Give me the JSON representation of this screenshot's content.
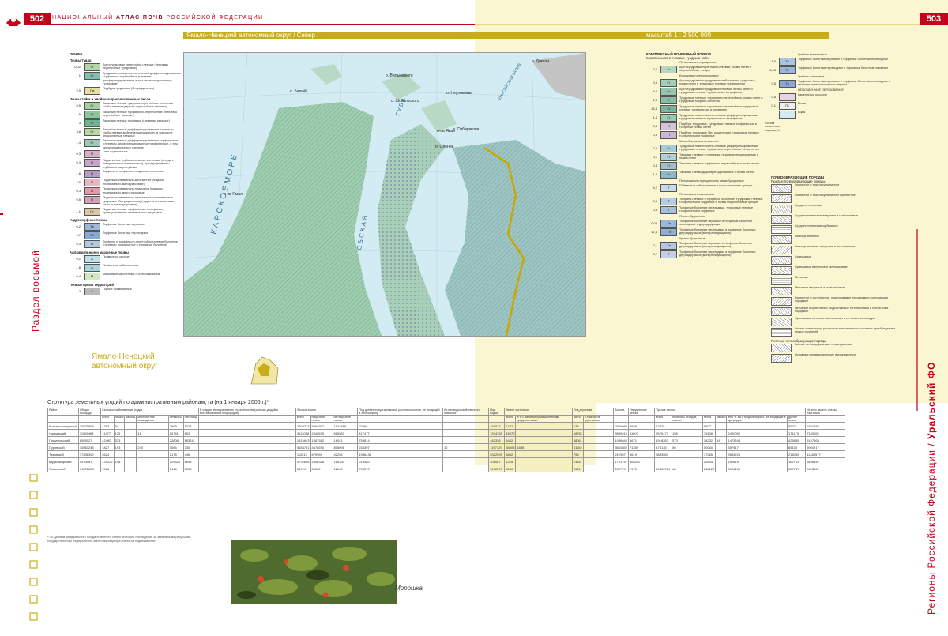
{
  "header": {
    "page_left": "502",
    "page_right": "503",
    "title_prefix": "НАЦИОНАЛЬНЫЙ",
    "title_main": "АТЛАС ПОЧВ",
    "title_suffix": "РОССИЙСКОЙ ФЕДЕРАЦИИ"
  },
  "map_bar": {
    "title": "Ямало-Ненецкий автономный округ / Север",
    "scale": "масштаб 1 : 2 500 000"
  },
  "side_text": {
    "left": "Раздел восьмой",
    "right_a": "Регионы Российской Федерации / ",
    "right_b": "Уральский ФО"
  },
  "map_labels": {
    "sea": "К А Р С К О Е   М О Р Е",
    "island_bely": "о. Белый",
    "island_vilkitsky": "о. Вилькицкого",
    "island_shokalsky": "о. Шокальского",
    "island_neupokoeva": "о. Неупокоева",
    "island_sibiryakova": "о. Сибирякова",
    "island_yavai": "п-ов Явай",
    "island_oleniy": "о. Олений",
    "island_dikson": "о. Диксон",
    "yamal": "п-ов Ямал",
    "ob": "О Б С К А Я",
    "guba": "Г У Б А",
    "yenisey": "ЕНИСЕЙСКИЙ ЗАЛИВ",
    "inset": "Ямало-Ненецкий автономный округ"
  },
  "soil_legend": {
    "title": "ПОЧВЫ",
    "groups": [
      {
        "title": "Почвы тундр",
        "rows": [
          {
            "num": "0,02",
            "code": "Гт",
            "color": "#b7d3a8",
            "text": "Арктотундровые перегнойно-глеевые (глееземы перегнойные тундровые)"
          },
          {
            "num": "1",
            "code": "Гт",
            "color": "#7fbfb0",
            "text": "Тундровые поверхностно-глеевые дифференцированные торфянисто-перегнойные (глееземы дифференцированные, в том числе оподзоленные, тундровые)"
          },
          {
            "num": "2,9",
            "code": "Пм",
            "color": "#e6e0a6",
            "text": "Подбуры тундровые (без разделения)"
          }
        ]
      },
      {
        "title": "Почвы тайги и хвойно-широколиственных лесов",
        "rows": [
          {
            "num": "0,5",
            "code": "Гт",
            "color": "#a7cfa4",
            "text": "Таежные глеевые гумусово-перегнойные (глееземы слабоглеевые гумусово-перегнойные таежные)"
          },
          {
            "num": "1,5",
            "code": "Гт",
            "color": "#8cc49c",
            "text": "Таежные глеевые торфянисто-перегнойные (глееземы перегнойные таежные)"
          },
          {
            "num": "3",
            "code": "Гт",
            "color": "#6fb690",
            "text": "Таежные глеевые торфяные (глееземы таежные)"
          },
          {
            "num": "3,8",
            "code": "Гт",
            "color": "#b9d8a0",
            "text": "Таежные глеевые дифференцированные (глееземы слабоглеевые дифференцированные), в том числе оподзоленные таежные"
          },
          {
            "num": "1,4",
            "code": "Гт",
            "color": "#9fc9b4",
            "text": "Таежные глеевые дифференцированные торфянистые (глееземы дифференцированные торфянистые), в том числе оподзоленные таежные"
          },
          {
            "num": "0,3",
            "code": "П",
            "color": "#d6b0c8",
            "text": "Глее-подзолистые"
          },
          {
            "num": "0,3",
            "code": "П",
            "color": "#c9a6c9",
            "text": "Подзолистые глубокоглееватые и глеевые (иногда с поверхностной глееватостью), преимущественно глубокие и сверхглубокие"
          },
          {
            "num": "1,6",
            "code": "П",
            "color": "#b89cc5",
            "text": "Торфяно- и торфянисто-подзолисто-глеевые"
          },
          {
            "num": "4,6",
            "code": "П",
            "color": "#e4b7c1",
            "text": "Подзолы иллювиально-железистые (подзолы иллювиально-малогумусовые)"
          },
          {
            "num": "0,3",
            "code": "П",
            "color": "#e29aa8",
            "text": "Подзолы иллювиально-гумусовые (подзолы иллювиально-многогумусовые)"
          },
          {
            "num": "0,5",
            "code": "П",
            "color": "#cfa2b8",
            "text": "Подзолы иллювиально-железистые и иллювиально-гумусовые (без разделения) (подзолы иллювиально-мало- и многогумусовые)"
          },
          {
            "num": "1,1",
            "code": "Пт",
            "color": "#d8c9a3",
            "text": "Подзолы глеевые торфянистые и торфяные, преимущественно иллювиально-гумусовые"
          }
        ]
      },
      {
        "title": "Гидроморфные почвы",
        "rows": [
          {
            "num": "0,2",
            "code": "Тв",
            "color": "#9fb6d9",
            "text": "Торфяные болотные верховые"
          },
          {
            "num": "0,7",
            "code": "Тн",
            "color": "#85a9cf",
            "text": "Торфяные болотные переходные"
          },
          {
            "num": "0,3",
            "code": "Тг",
            "color": "#b6c7e2",
            "text": "Торфяно- и торфянисто-перегнойно-глеевые болотные (глееземы торфянистые и торфяные болотные)"
          }
        ]
      },
      {
        "title": "Аллювиальные и маршевые почвы",
        "rows": [
          {
            "num": "0,1",
            "code": "А",
            "color": "#c0dfe6",
            "text": "Пойменные кислые"
          },
          {
            "num": "1,8",
            "code": "А",
            "color": "#a6d3dc",
            "text": "Пойменные заболоченные"
          },
          {
            "num": "0,4",
            "code": "М",
            "color": "#d3e7c3",
            "text": "Маршевые засоленные и солончаковатые"
          }
        ]
      },
      {
        "title": "Почвы горных территорий",
        "rows": [
          {
            "num": "1,2",
            "code": "Г",
            "color": "#b9b9b9",
            "text": "Горные примитивные"
          }
        ]
      }
    ]
  },
  "complex_legend": {
    "title": "КОМПЛЕКСНЫЙ ПОЧВЕННЫЙ ПОКРОВ",
    "subtitle": "Комплексы почв Арктики, тундры и тайги",
    "rows": [
      {
        "num": "",
        "code": "",
        "color": "",
        "text": "Полигонально-трещинные"
      },
      {
        "num": "0,7",
        "code": "Гт",
        "color": "#b8d7c1",
        "text": "Арктотундровые перегнойно-глеевые, почвы пятен и морозобойных трещин"
      },
      {
        "num": "",
        "code": "",
        "color": "",
        "text": "Бугорковые мелкорошковые"
      },
      {
        "num": "0,4",
        "code": "Гт",
        "color": "#a6cdb9",
        "text": "Арктотундровые и тундровые слабоглеевые гумусовые, почвы пятен и тундровые глеевые торфянистые"
      },
      {
        "num": "6,5",
        "code": "Гт",
        "color": "#95c5b1",
        "text": "Арктотундровые и тундровые глеевые, почвы пятен и тундровые глеевые торфянистые и торфяные"
      },
      {
        "num": "2,5",
        "code": "Гт",
        "color": "#88bda6",
        "text": "Тундровые глеевые торфянисто-перегнойные, почвы пятен и тундровые торфяно-болотные"
      },
      {
        "num": "15,3",
        "code": "Гт",
        "color": "#7bb39c",
        "text": "Тундровые глеевые торфянисто-перегнойные, тундровые глеевые торфянистые и торфяные"
      },
      {
        "num": "1,4",
        "code": "Гт",
        "color": "#9bcab2",
        "text": "Тундровые поверхностно-глеевые дифференцированные, тундровые глеевые торфянистые и торфяные"
      },
      {
        "num": "0,4",
        "code": "П",
        "color": "#d6c2d7",
        "text": "Подбуры тундровые, тундровые глеевые торфянистые и торфяные почвы пятен"
      },
      {
        "num": "0,3",
        "code": "П",
        "color": "#cab8d3",
        "text": "Подбуры тундровые (без разделения), тундровые глеевые торфянистые и торфяные"
      },
      {
        "num": "",
        "code": "",
        "color": "",
        "text": "Мелкобугорково-пятнистые"
      },
      {
        "num": "2,2",
        "code": "Гт",
        "color": "#a5cbd4",
        "text": "Тундровые поверхностно-глеевые дифференцированные, тундровые глеевые торфянисто-перегнойные почвы пятен"
      },
      {
        "num": "0,1",
        "code": "Гт",
        "color": "#b2d0da",
        "text": "Таежные глеевые и глееватые недифференцированные и почвы пятен"
      },
      {
        "num": "0,8",
        "code": "Гт",
        "color": "#9ec0ce",
        "text": "Таежные глеевые торфянисто-перегнойные и почвы пятен"
      },
      {
        "num": "1,9",
        "code": "Гт",
        "color": "#8fb7c6",
        "text": "Таежные глеево-дифференцированные и почвы пятен"
      },
      {
        "num": "",
        "code": "",
        "color": "",
        "text": "Полигонально-трещинные и мелкобугорковые"
      },
      {
        "num": "4,2",
        "code": "Т",
        "color": "#c7dbe8",
        "text": "Пойменные заболоченные и почвы морозных трещин"
      },
      {
        "num": "",
        "code": "",
        "color": "",
        "text": "Полигонально-валиковые"
      },
      {
        "num": "9,5",
        "code": "Т",
        "color": "#b5cbe3",
        "text": "Торфяно-глеевые и торфяные болотные, тундровые глеевые торфянистые и торфяные и почвы морозобойных трещин"
      },
      {
        "num": "0,3",
        "code": "Т",
        "color": "#a8c0de",
        "text": "Торфяные болотные переходные, тундровые глеевые торфянистые и торфяные"
      },
      {
        "num": "",
        "code": "",
        "color": "",
        "text": "Плоско-бугристые"
      },
      {
        "num": "0,05",
        "code": "Тв",
        "color": "#9db7d9",
        "text": "Торфяные болотные верховые и торфяные болотные переходные и деградирующие"
      },
      {
        "num": "12,4",
        "code": "Тн",
        "color": "#8eaed3",
        "text": "Торфяные болотные переходные и торфяные болотные деградирующие (минерализующиеся)"
      },
      {
        "num": "",
        "code": "",
        "color": "",
        "text": "Крупно-бугристые"
      },
      {
        "num": "0,1",
        "code": "Тв",
        "color": "#b7c6e0",
        "text": "Торфяные болотные верховые и торфяные болотные деградирующие (минерализующиеся)"
      },
      {
        "num": "0,7",
        "code": "Т",
        "color": "#c4cfe5",
        "text": "Торфяные болотные переходные и торфяные болотные деградирующие (минерализующиеся)"
      }
    ]
  },
  "right_legend": {
    "rows": [
      {
        "num": "",
        "code": "",
        "color": "",
        "text": "Грядово-мочажинные"
      },
      {
        "num": "1,0",
        "code": "Тв",
        "color": "#a9c3e1",
        "text": "Торфяные болотные верховые и торфяные болотные переходные"
      },
      {
        "num": "0,03",
        "code": "Тн",
        "color": "#9ab4da",
        "text": "Торфяные болотные переходные и торфяные болотные низинные"
      },
      {
        "num": "",
        "code": "",
        "color": "",
        "text": "Грядово-озерковые"
      },
      {
        "num": "0,5",
        "code": "Тв",
        "color": "#8ba8d2",
        "text": "Торфяные болотные верховые и торфяные болотные переходные с мелкими термокарстовыми озерами"
      },
      {
        "num": "",
        "code": "",
        "color": "",
        "text": "НЕПОЧВЕННЫЕ ОБРАЗОВАНИЯ"
      },
      {
        "num": "0,5",
        "code": "",
        "color": "#e7d3e8",
        "text": "Каменистые россыпи"
      },
      {
        "num": "0,1",
        "code": "Пс",
        "color": "#eeeeee",
        "text": "Пески"
      },
      {
        "num": "",
        "code": "",
        "color": "#d2ebf3",
        "text": "Воды"
      }
    ],
    "note": "Состав почвенного покрова, %"
  },
  "rocks_legend": {
    "title": "ПОЧВООБРАЗУЮЩИЕ ПОРОДЫ",
    "subtitle": "Рыхлые почвообразующие породы",
    "items": [
      "Глинистые и тяжелосуглинистые",
      "Глинистые и тяжелосуглинистые щебнистые",
      "Среднесуглинистые",
      "Среднесуглинистые валунные и галечниковые",
      "Среднесуглинистые щебнистые",
      "Легкосуглинистые",
      "Легкосуглинистые валунные и галечниковые",
      "Супесчаные",
      "Супесчаные валунные и галечниковые",
      "Песчаные",
      "Песчаные валунные и галечниковые",
      "Глинистые и суглинистые, подстилаемые песчаными и супесчаными породами",
      "Песчаные и супесчаные, подстилаемые суглинистыми и глинистыми породами",
      "Супесчаные на слоистых песчаных и суглинистых породах",
      "Частая смена пород различного механического состава с преобладанием песков и супесей"
    ],
    "subtitle2": "Плотные почвообразующие породы",
    "items2": [
      "Кислые метаморфические и изверженные",
      "Основные метаморфические и изверженные"
    ]
  },
  "table": {
    "title": "Структура земельных угодий по административным районам, га (на 1 января 2006 г.)*",
    "headers": {
      "district": "Район",
      "total_area": "Общая площадь",
      "agri": "Сельскохозяйственные угодья",
      "total": "всего",
      "including": "в том числе",
      "arable": "пашня",
      "fallow": "залежь",
      "perennial": "многолетние насаждения",
      "hayfields": "сенокосы",
      "pastures": "пастбища",
      "construction": "В стадии мелиоративного строительства (сельско-угодий и восстановления плодородия)",
      "forest": "Лесные земли",
      "forested": "покрытые лесом",
      "unforested": "не покрытые лесом",
      "shrubs": "Под древесно-кустарниковой растительностью, не входящей в лесной фонд",
      "water_arr": "Из них водохозяйственного значения",
      "under_water": "Под водой",
      "built": "Земли застройки",
      "incl_built": "в т. ч. занятые промышленными предприятиями",
      "roads": "Под дорогами",
      "incl_roads": "в том числе грунтовыми",
      "swamps": "Болота",
      "disturbed": "Нарушенные земли",
      "other": "Прочие земли",
      "sands": "пески",
      "ravines": "овраги",
      "polygons": "полигоны отходов, свалки",
      "reindeer": "зем. уг-ья с тундровой раст., не входящие в др. угодия",
      "other_land": "другие земли",
      "reindeer_pastures": "Из всех земель оленьи пастбища"
    },
    "rows": [
      [
        "Красноселькупский",
        "10675899",
        "4303",
        "50",
        "",
        "",
        "2963",
        "1318",
        "",
        "7500713",
        "5064507",
        "1824868",
        "22398",
        "",
        "454517",
        "1787",
        "",
        "633",
        "",
        "2576080",
        "3598",
        "12828",
        "",
        "6802",
        "",
        "",
        "5977",
        "6321682"
      ],
      [
        "Надымский",
        "11095463",
        "11477",
        "125",
        "",
        "11",
        "10741",
        "692",
        "",
        "3113058",
        "2540575",
        "565983",
        "417477",
        "",
        "1574155",
        "15072",
        "",
        "18781",
        "",
        "3589219",
        "11007",
        "2679477",
        "155",
        "79108",
        "",
        "2420052",
        "171170",
        "7150052"
      ],
      [
        "Приуральский",
        "8559127",
        "42480",
        "333",
        "",
        "",
        "22808",
        "18324",
        "",
        "1415643",
        "1387582",
        "18041",
        "753814",
        "",
        "462336",
        "4442",
        "",
        "5806",
        "",
        "1096646",
        "1671",
        "1918283",
        "573",
        "18232",
        "18",
        "1473543",
        "426885",
        "5157563"
      ],
      [
        "Пуровский",
        "10863245",
        "1827",
        "193",
        "",
        "240",
        "1064",
        "330",
        "",
        "5184761",
        "4378690",
        "806091",
        "235397",
        "12",
        "1197129",
        "38503",
        "1838",
        "41152",
        "",
        "3610852",
        "71309",
        "473135",
        "50",
        "50060",
        "",
        "357917",
        "65108",
        "5904717"
      ],
      [
        "Тазовский",
        "17436392",
        "2624",
        "",
        "",
        "",
        "2178",
        "446",
        "",
        "110213",
        "679959",
        "42254",
        "1946438",
        "",
        "5322595",
        "4832",
        "",
        "755",
        "",
        "212957",
        "5619",
        "9833550",
        "",
        "77265",
        "",
        "9534226",
        "216059",
        "11489577"
      ],
      [
        "Шурышкарский",
        "5474081",
        "129222",
        "148",
        "",
        "",
        "129424",
        "8648",
        "",
        "2732656",
        "2546326",
        "185330",
        "213482",
        "",
        "208087",
        "1205",
        "",
        "2316",
        "",
        "1723757",
        "383252",
        "",
        "",
        "20834",
        "",
        "190615",
        "162713",
        "3406442"
      ],
      [
        "Ямальский",
        "14872653",
        "9986",
        "",
        "",
        "",
        "5448",
        "3238",
        "",
        "51924",
        "39682",
        "12242",
        "708570",
        "",
        "3172873",
        "4030",
        "",
        "2641",
        "",
        "232774",
        "7175",
        "10802954",
        "48",
        "238123",
        "",
        "8984160",
        "857747",
        "9678822"
      ]
    ],
    "footnote": "* По данным федерального государственного статистического наблюдения за земельными ресурсами, государственного Федерального агентства кадастра объектов недвижимости."
  },
  "photo_caption": "Морошка"
}
